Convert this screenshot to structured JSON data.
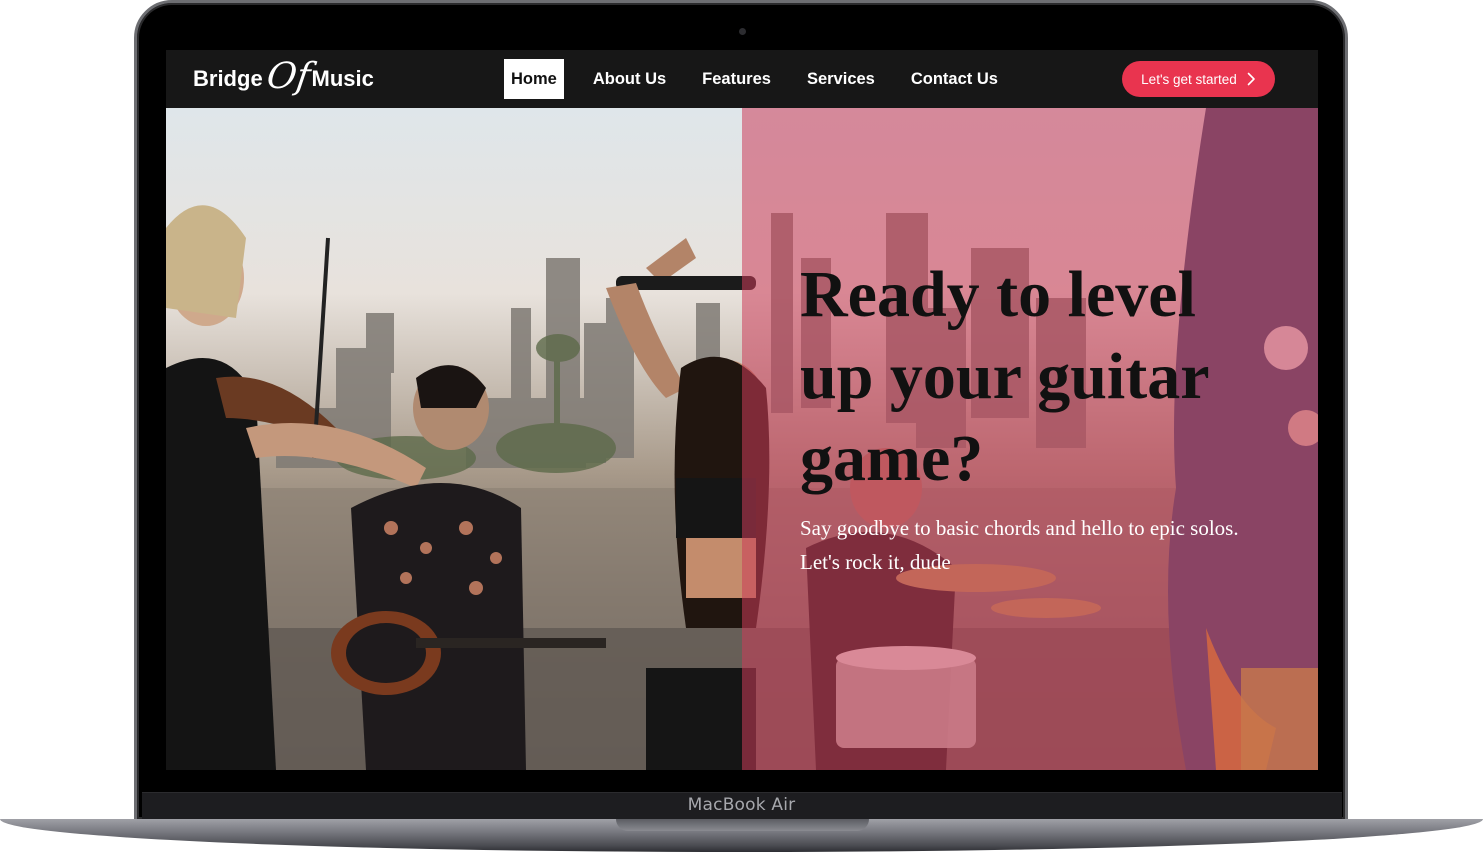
{
  "device": {
    "model_label": "MacBook Air"
  },
  "navbar": {
    "logo": {
      "part1": "Bridge",
      "part2": "Of",
      "part3": "Music"
    },
    "links": [
      {
        "label": "Home",
        "active": true
      },
      {
        "label": "About Us",
        "active": false
      },
      {
        "label": "Features",
        "active": false
      },
      {
        "label": "Services",
        "active": false
      },
      {
        "label": "Contact Us",
        "active": false
      }
    ],
    "cta_label": "Let's get started",
    "cta_icon": "chevron-right-icon"
  },
  "hero": {
    "headline": "Ready to level up your guitar game?",
    "subtext": "Say goodbye to basic chords and hello to epic solos. Let's rock it, dude",
    "image_description_icon": "band-photo"
  },
  "colors": {
    "accent": "#e9344f",
    "navbar_bg": "#171717",
    "overlay": "#cc3c5a"
  }
}
